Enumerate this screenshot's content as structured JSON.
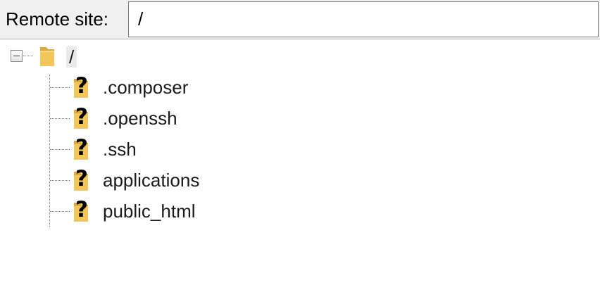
{
  "header": {
    "label": "Remote site:",
    "path_value": "/"
  },
  "tree": {
    "root": {
      "label": "/",
      "expanded": true,
      "icon": "folder-icon"
    },
    "children": [
      {
        "label": ".composer",
        "icon": "unknown-folder-icon"
      },
      {
        "label": ".openssh",
        "icon": "unknown-folder-icon"
      },
      {
        "label": ".ssh",
        "icon": "unknown-folder-icon"
      },
      {
        "label": "applications",
        "icon": "unknown-folder-icon"
      },
      {
        "label": "public_html",
        "icon": "unknown-folder-icon"
      }
    ]
  },
  "colors": {
    "folder": "#f3c65a",
    "folder_dark": "#dba93a",
    "header_bg": "#f0f0f0",
    "selection_bg": "#eaeaea"
  }
}
